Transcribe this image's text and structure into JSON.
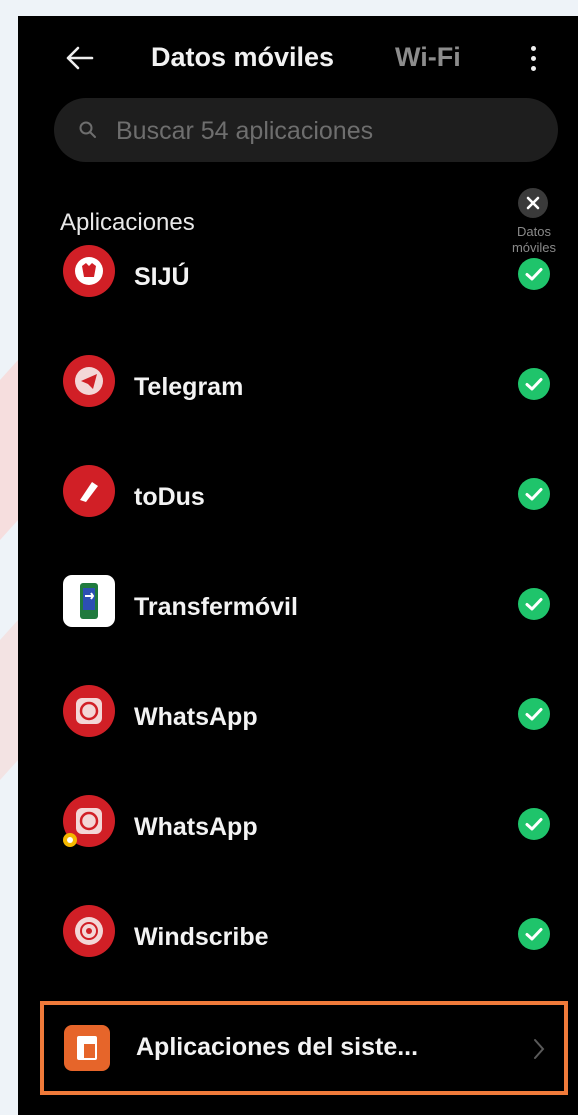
{
  "header": {
    "title": "Datos móviles",
    "tab_wifi": "Wi-Fi"
  },
  "search": {
    "placeholder": "Buscar 54 aplicaciones"
  },
  "section": {
    "title": "Aplicaciones",
    "column_label_line1": "Datos",
    "column_label_line2": "móviles"
  },
  "apps": [
    {
      "name": "SIJÚ",
      "icon": "sijú-app-icon",
      "enabled": true
    },
    {
      "name": "Telegram",
      "icon": "telegram-app-icon",
      "enabled": true
    },
    {
      "name": "toDus",
      "icon": "todus-app-icon",
      "enabled": true
    },
    {
      "name": "Transfermóvil",
      "icon": "transfermovil-app-icon",
      "enabled": true
    },
    {
      "name": "WhatsApp",
      "icon": "whatsapp-app-icon",
      "enabled": true
    },
    {
      "name": "WhatsApp",
      "icon": "whatsapp-dual-app-icon",
      "enabled": true
    },
    {
      "name": "Windscribe",
      "icon": "windscribe-app-icon",
      "enabled": true
    }
  ],
  "system_apps": {
    "label": "Aplicaciones del siste..."
  },
  "colors": {
    "background": "#000000",
    "check": "#1fc46b",
    "highlight": "#f07a3a",
    "system_icon": "#e6652a"
  }
}
